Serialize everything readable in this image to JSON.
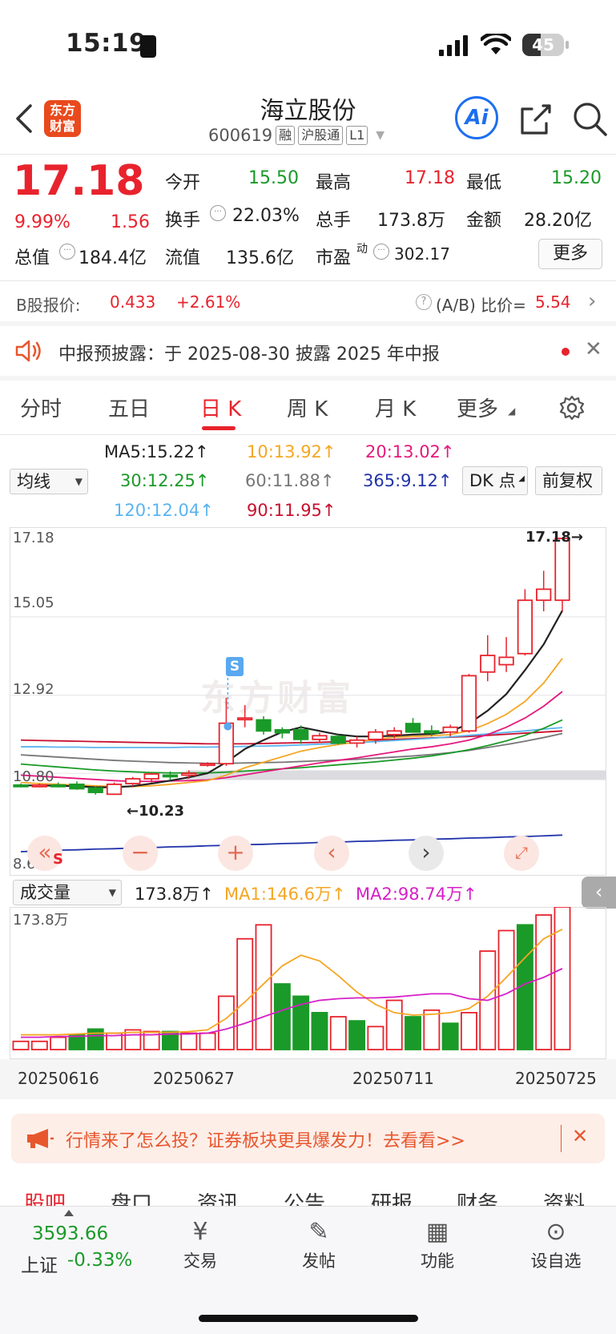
{
  "status_bar": {
    "time": "15:19",
    "battery": "45"
  },
  "header": {
    "logo_line1": "东方",
    "logo_line2": "财富",
    "title": "海立股份",
    "code": "600619",
    "tags": [
      "融",
      "沪股通",
      "L1"
    ],
    "ai_label": "Ai"
  },
  "quote": {
    "price": "17.18",
    "change_pct": "9.99%",
    "change": "1.56",
    "open_label": "今开",
    "open": "15.50",
    "high_label": "最高",
    "high": "17.18",
    "low_label": "最低",
    "low": "15.20",
    "turnover_label": "换手",
    "turnover": "22.03%",
    "volume_label": "总手",
    "volume": "173.8万",
    "amount_label": "金额",
    "amount": "28.20亿",
    "mktcap_label": "总值",
    "mktcap": "184.4亿",
    "float_label": "流值",
    "float_cap": "135.6亿",
    "pe_label": "市盈",
    "pe_sup": "动",
    "pe": "302.17",
    "more_label": "更多"
  },
  "bshare": {
    "label": "B股报价:",
    "price": "0.433",
    "change": "+2.61%",
    "ratio_label": "(A/B) 比价=",
    "ratio": "5.54"
  },
  "notice": {
    "text": "中报预披露：于 2025-08-30 披露 2025 年中报"
  },
  "tabs": [
    "分时",
    "五日",
    "日 K",
    "周 K",
    "月 K",
    "更多"
  ],
  "ma": {
    "ma5": "MA5:15.22↑",
    "ma10": "10:13.92↑",
    "ma20": "20:13.02↑",
    "ma30": "30:12.25↑",
    "ma60": "60:11.88↑",
    "ma365": "365:9.12↑",
    "ma120": "120:12.04↑",
    "ma90": "90:11.95↑",
    "select_label": "均线",
    "dk_label": "DK 点",
    "adjust_label": "前复权",
    "colors": {
      "ma5": "#222222",
      "ma10": "#f5a623",
      "ma20": "#e5197d",
      "ma30": "#1a9a28",
      "ma60": "#777777",
      "ma365": "#2233aa",
      "ma120": "#5ab4f0",
      "ma90": "#c8102e"
    }
  },
  "kline": {
    "y_labels": [
      "17.18",
      "15.05",
      "12.92",
      "10.80",
      "8.67"
    ],
    "high_mark": "17.18→",
    "low_mark": "←10.23",
    "s_marker": "S",
    "watermark": "东方财富"
  },
  "volume_panel": {
    "select_label": "成交量",
    "vol": "173.8万↑",
    "ma1": "MA1:146.6万↑",
    "ma2": "MA2:98.74万↑",
    "y_top": "173.8万"
  },
  "dates": [
    "20250616",
    "20250627",
    "20250711",
    "20250725"
  ],
  "chart_data": [
    {
      "type": "candlestick",
      "title": "",
      "x": [
        "20250616",
        "20250627",
        "20250711",
        "20250725"
      ],
      "ylim": [
        8.67,
        17.18
      ],
      "candles": [
        {
          "o": 10.48,
          "h": 10.52,
          "l": 10.42,
          "c": 10.45
        },
        {
          "o": 10.46,
          "h": 10.52,
          "l": 10.42,
          "c": 10.48
        },
        {
          "o": 10.48,
          "h": 10.55,
          "l": 10.42,
          "c": 10.46
        },
        {
          "o": 10.5,
          "h": 10.58,
          "l": 10.35,
          "c": 10.38
        },
        {
          "o": 10.4,
          "h": 10.45,
          "l": 10.22,
          "c": 10.28
        },
        {
          "o": 10.23,
          "h": 10.55,
          "l": 10.23,
          "c": 10.5
        },
        {
          "o": 10.52,
          "h": 10.7,
          "l": 10.45,
          "c": 10.65
        },
        {
          "o": 10.65,
          "h": 10.82,
          "l": 10.55,
          "c": 10.78
        },
        {
          "o": 10.75,
          "h": 10.85,
          "l": 10.62,
          "c": 10.72
        },
        {
          "o": 10.75,
          "h": 10.88,
          "l": 10.65,
          "c": 10.8
        },
        {
          "o": 11.02,
          "h": 11.1,
          "l": 10.98,
          "c": 11.06
        },
        {
          "o": 11.06,
          "h": 12.85,
          "l": 11.0,
          "c": 12.16
        },
        {
          "o": 12.3,
          "h": 12.65,
          "l": 12.05,
          "c": 12.3
        },
        {
          "o": 12.25,
          "h": 12.35,
          "l": 11.85,
          "c": 11.95
        },
        {
          "o": 11.98,
          "h": 12.05,
          "l": 11.75,
          "c": 11.9
        },
        {
          "o": 11.98,
          "h": 12.1,
          "l": 11.6,
          "c": 11.72
        },
        {
          "o": 11.72,
          "h": 11.9,
          "l": 11.62,
          "c": 11.82
        },
        {
          "o": 11.8,
          "h": 11.85,
          "l": 11.58,
          "c": 11.62
        },
        {
          "o": 11.62,
          "h": 11.8,
          "l": 11.5,
          "c": 11.7
        },
        {
          "o": 11.72,
          "h": 12.0,
          "l": 11.6,
          "c": 11.92
        },
        {
          "o": 11.85,
          "h": 12.05,
          "l": 11.75,
          "c": 11.95
        },
        {
          "o": 12.15,
          "h": 12.3,
          "l": 11.9,
          "c": 11.92
        },
        {
          "o": 11.95,
          "h": 12.1,
          "l": 11.8,
          "c": 11.9
        },
        {
          "o": 11.92,
          "h": 12.12,
          "l": 11.8,
          "c": 12.05
        },
        {
          "o": 11.95,
          "h": 13.5,
          "l": 11.9,
          "c": 13.45
        },
        {
          "o": 13.55,
          "h": 14.55,
          "l": 13.3,
          "c": 14.0
        },
        {
          "o": 13.75,
          "h": 14.5,
          "l": 13.55,
          "c": 13.95
        },
        {
          "o": 14.05,
          "h": 15.8,
          "l": 14.0,
          "c": 15.5
        },
        {
          "o": 15.5,
          "h": 16.3,
          "l": 15.2,
          "c": 15.8
        },
        {
          "o": 15.5,
          "h": 17.18,
          "l": 15.2,
          "c": 17.18
        }
      ],
      "ma_lines": {
        "ma5": [
          10.47,
          10.47,
          10.46,
          10.45,
          10.42,
          10.42,
          10.45,
          10.52,
          10.6,
          10.69,
          10.8,
          11.1,
          11.46,
          11.7,
          11.92,
          12.05,
          11.95,
          11.85,
          11.8,
          11.8,
          11.82,
          11.85,
          11.87,
          11.93,
          12.15,
          12.5,
          12.95,
          13.6,
          14.3,
          15.22
        ],
        "ma10": [
          10.55,
          10.52,
          10.5,
          10.48,
          10.46,
          10.44,
          10.44,
          10.46,
          10.5,
          10.55,
          10.6,
          10.75,
          10.95,
          11.1,
          11.25,
          11.4,
          11.5,
          11.58,
          11.65,
          11.72,
          11.78,
          11.8,
          11.82,
          11.85,
          11.95,
          12.15,
          12.4,
          12.75,
          13.25,
          13.92
        ],
        "ma20": [
          10.75,
          10.72,
          10.69,
          10.66,
          10.63,
          10.6,
          10.58,
          10.58,
          10.59,
          10.6,
          10.62,
          10.68,
          10.76,
          10.84,
          10.92,
          11.0,
          11.08,
          11.15,
          11.22,
          11.3,
          11.38,
          11.46,
          11.52,
          11.6,
          11.7,
          11.85,
          12.05,
          12.3,
          12.62,
          13.02
        ],
        "ma30": [
          11.05,
          11.01,
          10.97,
          10.93,
          10.89,
          10.86,
          10.84,
          10.82,
          10.81,
          10.81,
          10.81,
          10.83,
          10.86,
          10.89,
          10.92,
          10.95,
          10.99,
          11.03,
          11.07,
          11.11,
          11.16,
          11.21,
          11.27,
          11.35,
          11.44,
          11.55,
          11.68,
          11.83,
          12.02,
          12.25
        ],
        "ma60": [
          11.3,
          11.27,
          11.24,
          11.21,
          11.18,
          11.15,
          11.13,
          11.11,
          11.09,
          11.08,
          11.07,
          11.07,
          11.08,
          11.09,
          11.1,
          11.12,
          11.14,
          11.16,
          11.18,
          11.21,
          11.24,
          11.27,
          11.31,
          11.36,
          11.42,
          11.5,
          11.58,
          11.67,
          11.77,
          11.88
        ],
        "ma90": [
          11.7,
          11.69,
          11.68,
          11.67,
          11.66,
          11.65,
          11.64,
          11.63,
          11.62,
          11.61,
          11.6,
          11.6,
          11.6,
          11.61,
          11.62,
          11.63,
          11.64,
          11.66,
          11.68,
          11.7,
          11.72,
          11.74,
          11.76,
          11.78,
          11.8,
          11.83,
          11.86,
          11.89,
          11.92,
          11.95
        ],
        "ma120": [
          11.52,
          11.52,
          11.51,
          11.51,
          11.5,
          11.5,
          11.5,
          11.5,
          11.5,
          11.51,
          11.51,
          11.52,
          11.53,
          11.54,
          11.55,
          11.57,
          11.59,
          11.61,
          11.63,
          11.66,
          11.69,
          11.72,
          11.75,
          11.79,
          11.83,
          11.87,
          11.91,
          11.95,
          12.0,
          12.04
        ],
        "ma365": [
          8.67,
          8.69,
          8.71,
          8.72,
          8.74,
          8.75,
          8.77,
          8.78,
          8.8,
          8.81,
          8.83,
          8.84,
          8.86,
          8.87,
          8.89,
          8.9,
          8.92,
          8.93,
          8.95,
          8.96,
          8.98,
          8.99,
          9.01,
          9.02,
          9.04,
          9.05,
          9.07,
          9.08,
          9.1,
          9.12
        ]
      }
    },
    {
      "type": "bar",
      "title": "",
      "ylabel": "",
      "ylim": [
        0,
        173.8
      ],
      "unit": "万",
      "values": [
        10,
        10,
        15,
        18,
        25,
        20,
        24,
        22,
        22,
        20,
        20,
        65,
        135,
        152,
        80,
        65,
        45,
        40,
        35,
        28,
        60,
        40,
        48,
        32,
        45,
        120,
        145,
        152,
        164,
        173.8
      ],
      "up": [
        true,
        true,
        true,
        false,
        false,
        true,
        true,
        true,
        false,
        true,
        true,
        true,
        true,
        true,
        false,
        false,
        false,
        true,
        false,
        true,
        true,
        false,
        true,
        false,
        true,
        true,
        true,
        false,
        true,
        true
      ],
      "ma1": [
        18,
        18,
        18,
        19,
        20,
        20,
        21,
        21,
        21,
        22,
        24,
        38,
        58,
        80,
        102,
        115,
        108,
        90,
        70,
        55,
        45,
        42,
        43,
        45,
        50,
        65,
        88,
        112,
        135,
        146.6
      ],
      "ma2": [
        15,
        15,
        16,
        16,
        17,
        17,
        18,
        18,
        19,
        19,
        20,
        25,
        32,
        40,
        48,
        55,
        60,
        62,
        63,
        63,
        64,
        66,
        68,
        68,
        62,
        60,
        68,
        80,
        88,
        98.74
      ]
    }
  ],
  "banner": {
    "text": "行情来了怎么投？证券板块更具爆发力！去看看>>"
  },
  "bottom_tabs": [
    "股吧",
    "盘口",
    "资讯",
    "公告",
    "研报",
    "财务",
    "资料"
  ],
  "bottom_nav": {
    "index_value": "3593.66",
    "index_label": "上证",
    "index_change": "-0.33%",
    "items": [
      "交易",
      "发帖",
      "功能",
      "设自选"
    ]
  }
}
